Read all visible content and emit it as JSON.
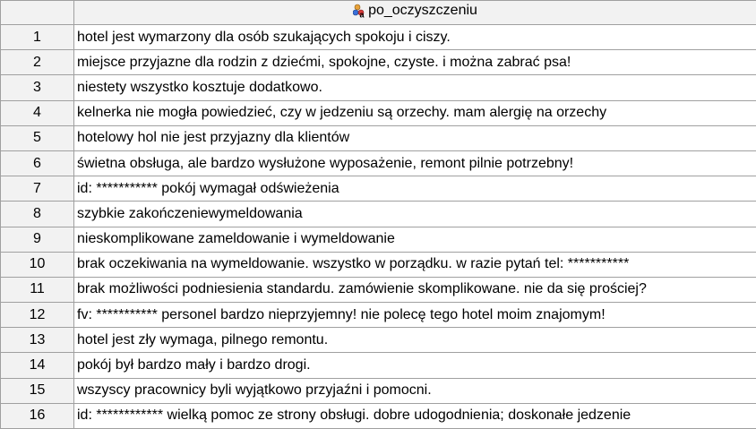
{
  "column": {
    "name": "po_oczyszczeniu",
    "icon": "nominal-variable-icon"
  },
  "rows": [
    {
      "num": "1",
      "text": "hotel jest wymarzony dla osób szukających spokoju i ciszy."
    },
    {
      "num": "2",
      "text": "miejsce przyjazne dla rodzin z dziećmi, spokojne, czyste. i można zabrać psa!"
    },
    {
      "num": "3",
      "text": "niestety wszystko kosztuje dodatkowo."
    },
    {
      "num": "4",
      "text": "kelnerka nie mogła powiedzieć, czy w jedzeniu są orzechy. mam alergię na orzechy"
    },
    {
      "num": "5",
      "text": "hotelowy hol nie jest przyjazny dla klientów"
    },
    {
      "num": "6",
      "text": "świetna obsługa, ale bardzo wysłużone wyposażenie, remont pilnie potrzebny!"
    },
    {
      "num": "7",
      "text": "id: *********** pokój wymagał odświeżenia"
    },
    {
      "num": "8",
      "text": "szybkie zakończeniewymeldowania"
    },
    {
      "num": "9",
      "text": "nieskomplikowane zameldowanie i wymeldowanie"
    },
    {
      "num": "10",
      "text": "brak oczekiwania na wymeldowanie. wszystko w porządku. w razie pytań tel: ***********"
    },
    {
      "num": "11",
      "text": "brak możliwości podniesienia standardu. zamówienie skomplikowane. nie da się prościej?"
    },
    {
      "num": "12",
      "text": "fv: *********** personel bardzo nieprzyjemny! nie polecę tego hotel moim znajomym!"
    },
    {
      "num": "13",
      "text": "hotel jest zły wymaga, pilnego remontu."
    },
    {
      "num": "14",
      "text": "pokój był bardzo mały i bardzo drogi."
    },
    {
      "num": "15",
      "text": "wszyscy pracownicy byli wyjątkowo przyjaźni i pomocni."
    },
    {
      "num": "16",
      "text": "id: ************ wielką pomoc ze strony obsługi. dobre udogodnienia; doskonałe jedzenie"
    }
  ]
}
